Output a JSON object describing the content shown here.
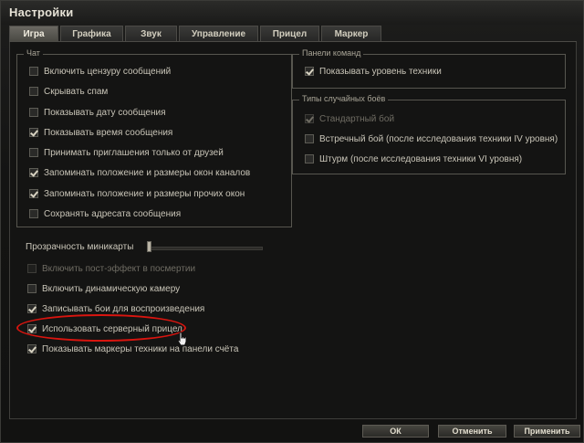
{
  "window": {
    "title": "Настройки"
  },
  "tabs": [
    {
      "label": "Игра",
      "active": true
    },
    {
      "label": "Графика",
      "active": false
    },
    {
      "label": "Звук",
      "active": false
    },
    {
      "label": "Управление",
      "active": false
    },
    {
      "label": "Прицел",
      "active": false
    },
    {
      "label": "Маркер",
      "active": false
    }
  ],
  "chat": {
    "legend": "Чат",
    "options": [
      {
        "label": "Включить цензуру сообщений",
        "checked": false
      },
      {
        "label": "Скрывать спам",
        "checked": false
      },
      {
        "label": "Показывать дату сообщения",
        "checked": false
      },
      {
        "label": "Показывать время сообщения",
        "checked": true
      },
      {
        "label": "Принимать приглашения только от друзей",
        "checked": false
      },
      {
        "label": "Запоминать положение и размеры окон каналов",
        "checked": true
      },
      {
        "label": "Запоминать положение и размеры прочих окон",
        "checked": true
      },
      {
        "label": "Сохранять адресата сообщения",
        "checked": false
      }
    ]
  },
  "team_panels": {
    "legend": "Панели команд",
    "options": [
      {
        "label": "Показывать уровень техники",
        "checked": true
      }
    ]
  },
  "battle_types": {
    "legend": "Типы случайных боёв",
    "options": [
      {
        "label": "Стандартный бой",
        "checked": true,
        "disabled": true
      },
      {
        "label": "Встречный бой (после исследования техники IV уровня)",
        "checked": false
      },
      {
        "label": "Штурм (после исследования техники VI уровня)",
        "checked": false
      }
    ]
  },
  "minimap": {
    "label": "Прозрачность миникарты",
    "value_fraction": 0.0
  },
  "misc": [
    {
      "label": "Включить пост-эффект в посмертии",
      "checked": false,
      "disabled": true
    },
    {
      "label": "Включить динамическую камеру",
      "checked": false
    },
    {
      "label": "Записывать бои для воспроизведения",
      "checked": true
    },
    {
      "label": "Использовать серверный прицел",
      "checked": true,
      "highlighted": true
    },
    {
      "label": "Показывать маркеры техники на панели счёта",
      "checked": true
    }
  ],
  "buttons": {
    "ok": "ОК",
    "cancel": "Отменить",
    "apply": "Применить"
  },
  "colors": {
    "highlight_ellipse": "#d9150f",
    "active_tab": "#5a5852"
  }
}
